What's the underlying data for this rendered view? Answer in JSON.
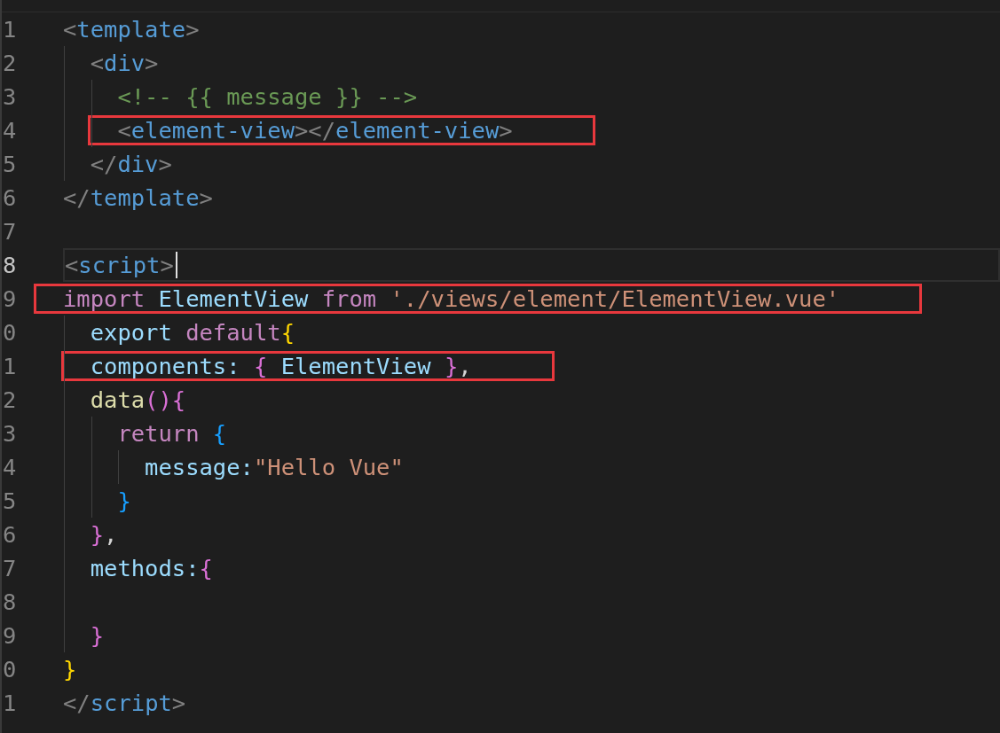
{
  "editor": {
    "lines": [
      {
        "number": "1",
        "current": false,
        "highlighted": false,
        "tokens": [
          {
            "kind": "punct",
            "text": "<"
          },
          {
            "kind": "tag",
            "text": "template"
          },
          {
            "kind": "punct",
            "text": ">"
          }
        ],
        "children": [
          {
            "number": "2",
            "current": false,
            "highlighted": false,
            "tokens": [
              {
                "kind": "punct",
                "text": "<"
              },
              {
                "kind": "tag",
                "text": "div"
              },
              {
                "kind": "punct",
                "text": ">"
              }
            ],
            "children": [
              {
                "number": "3",
                "current": false,
                "highlighted": false,
                "tokens": [
                  {
                    "kind": "comment",
                    "text": "<!-- {{ message }} -->"
                  }
                ]
              },
              {
                "number": "4",
                "current": false,
                "highlighted": true,
                "tokens": [
                  {
                    "kind": "punct",
                    "text": "<"
                  },
                  {
                    "kind": "tag",
                    "text": "element-view"
                  },
                  {
                    "kind": "punct",
                    "text": "></"
                  },
                  {
                    "kind": "tag",
                    "text": "element-view"
                  },
                  {
                    "kind": "punct",
                    "text": ">"
                  }
                ]
              }
            ]
          },
          {
            "number": "5",
            "current": false,
            "highlighted": false,
            "tokens": [
              {
                "kind": "punct",
                "text": "</"
              },
              {
                "kind": "tag",
                "text": "div"
              },
              {
                "kind": "punct",
                "text": ">"
              }
            ]
          }
        ]
      },
      {
        "number": "6",
        "current": false,
        "highlighted": false,
        "tokens": [
          {
            "kind": "punct",
            "text": "</"
          },
          {
            "kind": "tag",
            "text": "template"
          },
          {
            "kind": "punct",
            "text": ">"
          }
        ]
      },
      {
        "number": "7",
        "current": false,
        "highlighted": false
      },
      {
        "number": "8",
        "current": true,
        "highlighted": false,
        "tokens": [
          {
            "kind": "punct",
            "text": "<"
          },
          {
            "kind": "tag",
            "text": "script"
          },
          {
            "kind": "punct",
            "text": ">"
          }
        ]
      },
      {
        "number": "9",
        "current": false,
        "highlighted": true,
        "tokens": [
          {
            "kind": "keyword",
            "text": "import "
          },
          {
            "kind": "variable",
            "text": "ElementView "
          },
          {
            "kind": "keyword",
            "text": "from "
          },
          {
            "kind": "string",
            "text": "'./views/element/ElementView.vue'"
          }
        ],
        "children": [
          {
            "number": "0",
            "current": false,
            "highlighted": false,
            "tokens": [
              {
                "kind": "declaration",
                "text": "export "
              },
              {
                "kind": "keyword",
                "text": "default"
              },
              {
                "kind": "brace1",
                "text": "{"
              }
            ]
          },
          {
            "number": "1",
            "current": false,
            "highlighted": true,
            "tokens": [
              {
                "kind": "variable",
                "text": "components: "
              },
              {
                "kind": "brace2",
                "text": "{ "
              },
              {
                "kind": "variable",
                "text": "ElementView "
              },
              {
                "kind": "brace2",
                "text": "}"
              },
              {
                "kind": "text",
                "text": ","
              }
            ]
          },
          {
            "number": "2",
            "current": false,
            "highlighted": false,
            "tokens": [
              {
                "kind": "function",
                "text": "data"
              },
              {
                "kind": "brace2",
                "text": "()"
              },
              {
                "kind": "brace2",
                "text": "{"
              }
            ],
            "children": [
              {
                "number": "3",
                "current": false,
                "highlighted": false,
                "tokens": [
                  {
                    "kind": "keyword",
                    "text": "return "
                  },
                  {
                    "kind": "brace3",
                    "text": "{"
                  }
                ],
                "children": [
                  {
                    "number": "4",
                    "current": false,
                    "highlighted": false,
                    "tokens": [
                      {
                        "kind": "variable",
                        "text": "message:"
                      },
                      {
                        "kind": "string",
                        "text": "\"Hello Vue\""
                      }
                    ]
                  }
                ]
              },
              {
                "number": "5",
                "current": false,
                "highlighted": false,
                "tokens": [
                  {
                    "kind": "brace3",
                    "text": "}"
                  }
                ]
              }
            ]
          },
          {
            "number": "6",
            "current": false,
            "highlighted": false,
            "tokens": [
              {
                "kind": "brace2",
                "text": "}"
              },
              {
                "kind": "text",
                "text": ","
              }
            ]
          },
          {
            "number": "7",
            "current": false,
            "highlighted": false,
            "tokens": [
              {
                "kind": "variable",
                "text": "methods:"
              },
              {
                "kind": "brace2",
                "text": "{"
              }
            ]
          },
          {
            "number": "8",
            "current": false,
            "highlighted": false
          },
          {
            "number": "9",
            "current": false,
            "highlighted": false,
            "tokens": [
              {
                "kind": "brace2",
                "text": "}"
              }
            ]
          }
        ]
      },
      {
        "number": "0",
        "current": false,
        "highlighted": false,
        "tokens": [
          {
            "kind": "brace1",
            "text": "}"
          }
        ]
      },
      {
        "number": "1",
        "current": false,
        "highlighted": false,
        "tokens": [
          {
            "kind": "punct",
            "text": "</"
          },
          {
            "kind": "tag",
            "text": "script"
          },
          {
            "kind": "punct",
            "text": ">"
          }
        ]
      }
    ]
  }
}
